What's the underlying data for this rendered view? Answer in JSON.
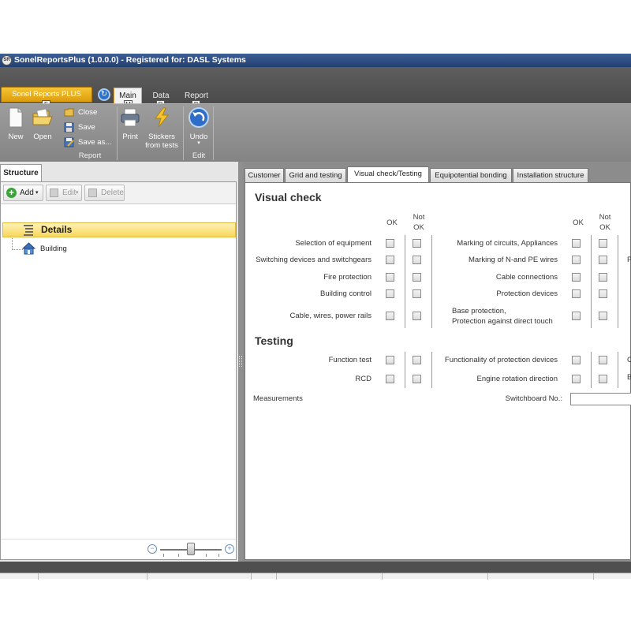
{
  "window": {
    "title": "SonelReportsPlus (1.0.0.0) - Registered for: DASL Systems",
    "app_icon_text": "SR"
  },
  "ribbon_tabs": {
    "app_menu": "Sonel Reports PLUS",
    "tabs": [
      {
        "label": "Main",
        "keytip": "M",
        "active": true
      },
      {
        "label": "Data",
        "keytip": "D",
        "active": false
      },
      {
        "label": "Report",
        "keytip": "P",
        "active": false
      }
    ],
    "app_keytip": "F"
  },
  "ribbon": {
    "report_group": {
      "label": "Report",
      "new": "New",
      "open": "Open",
      "close": "Close",
      "save": "Save",
      "save_as": "Save as..."
    },
    "print_group": {
      "print": "Print",
      "stickers": "Stickers\nfrom tests"
    },
    "edit_group": {
      "label": "Edit",
      "undo": "Undo"
    }
  },
  "left_panel": {
    "tab": "Structure",
    "toolbar": {
      "add": "Add",
      "edit": "Edit",
      "delete": "Delete"
    },
    "tree": [
      {
        "label": "Details",
        "selected": true
      },
      {
        "label": "Building",
        "selected": false
      }
    ]
  },
  "content_tabs": [
    {
      "label": "Customer",
      "active": false
    },
    {
      "label": "Grid and testing",
      "active": false
    },
    {
      "label": "Visual check/Testing",
      "active": true
    },
    {
      "label": "Equipotential bonding",
      "active": false
    },
    {
      "label": "Installation structure",
      "active": false
    }
  ],
  "visual_check": {
    "title": "Visual check",
    "col_ok": "OK",
    "col_not_ok_1": "Not",
    "col_not_ok_2": "OK",
    "left_items": [
      "Selection of equipment",
      "Switching devices and switchgears",
      "Fire protection",
      "Building control",
      "Cable, wires, power rails"
    ],
    "right_items": [
      "Marking of circuits, Appliances",
      "Marking of N-and PE wires",
      "Cable connections",
      "Protection devices"
    ],
    "right_item_5_line1": "Base protection,",
    "right_item_5_line2": "Protection against direct touch",
    "cut_text": "P"
  },
  "testing": {
    "title": "Testing",
    "left_items": [
      "Function test",
      "RCD"
    ],
    "right_items": [
      "Functionality of protection devices",
      "Engine rotation direction"
    ],
    "cut_text_1": "C",
    "cut_text_2": "B",
    "measurements": "Measurements",
    "switchboard_label": "Switchboard No.:",
    "switchboard_value": ""
  }
}
